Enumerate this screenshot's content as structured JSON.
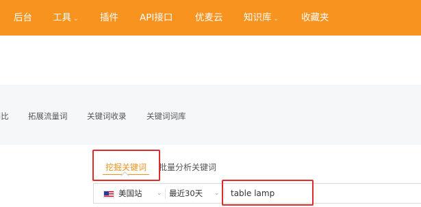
{
  "topnav": {
    "items": [
      {
        "label": "后台",
        "dropdown": false
      },
      {
        "label": "工具",
        "dropdown": true
      },
      {
        "label": "插件",
        "dropdown": false
      },
      {
        "label": "API接口",
        "dropdown": false
      },
      {
        "label": "优麦云",
        "dropdown": false
      },
      {
        "label": "知识库",
        "dropdown": true
      },
      {
        "label": "收藏夹",
        "dropdown": false
      }
    ],
    "background_color": "#f7931e"
  },
  "subnav": {
    "items": [
      "i比",
      "拓展流量词",
      "关键词收录",
      "关键词词库"
    ]
  },
  "search": {
    "tabs": [
      {
        "label": "挖掘关键词",
        "active": true
      },
      {
        "label": "批量分析关键词",
        "active": false
      }
    ],
    "site": {
      "flag_icon": "us-flag-icon",
      "label": "美国站"
    },
    "range": {
      "label": "最近30天"
    },
    "keyword_value": "table lamp",
    "accent_color": "#e8931e",
    "highlight_color": "#e02a2a"
  }
}
